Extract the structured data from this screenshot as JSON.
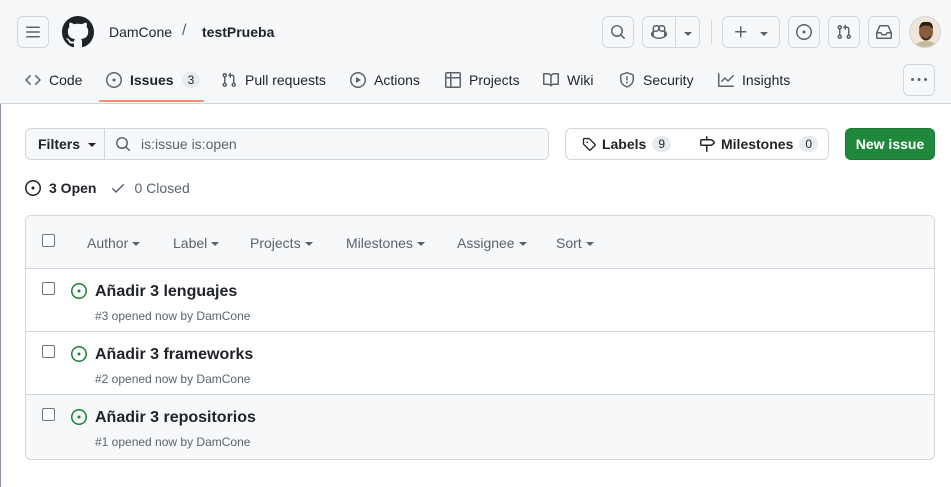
{
  "header": {
    "owner": "DamCone",
    "separator": "/",
    "repo": "testPrueba"
  },
  "tabs": [
    {
      "label": "Code"
    },
    {
      "label": "Issues",
      "count": "3"
    },
    {
      "label": "Pull requests"
    },
    {
      "label": "Actions"
    },
    {
      "label": "Projects"
    },
    {
      "label": "Wiki"
    },
    {
      "label": "Security"
    },
    {
      "label": "Insights"
    }
  ],
  "toolbar": {
    "filters_label": "Filters",
    "search_value": "is:issue is:open",
    "labels_label": "Labels",
    "labels_count": "9",
    "milestones_label": "Milestones",
    "milestones_count": "0",
    "new_issue_label": "New issue"
  },
  "state": {
    "open_label": "3 Open",
    "closed_label": "0 Closed"
  },
  "list_header": {
    "author": "Author",
    "label": "Label",
    "projects": "Projects",
    "milestones": "Milestones",
    "assignee": "Assignee",
    "sort": "Sort"
  },
  "issues": [
    {
      "title": "Añadir 3 lenguajes",
      "meta": "#3 opened now by DamCone"
    },
    {
      "title": "Añadir 3 frameworks",
      "meta": "#2 opened now by DamCone"
    },
    {
      "title": "Añadir 3 repositorios",
      "meta": "#1 opened now by DamCone"
    }
  ],
  "colors": {
    "accent_green": "#1f883d",
    "open_icon": "#1a7f37",
    "tab_underline": "#fd8c73"
  }
}
